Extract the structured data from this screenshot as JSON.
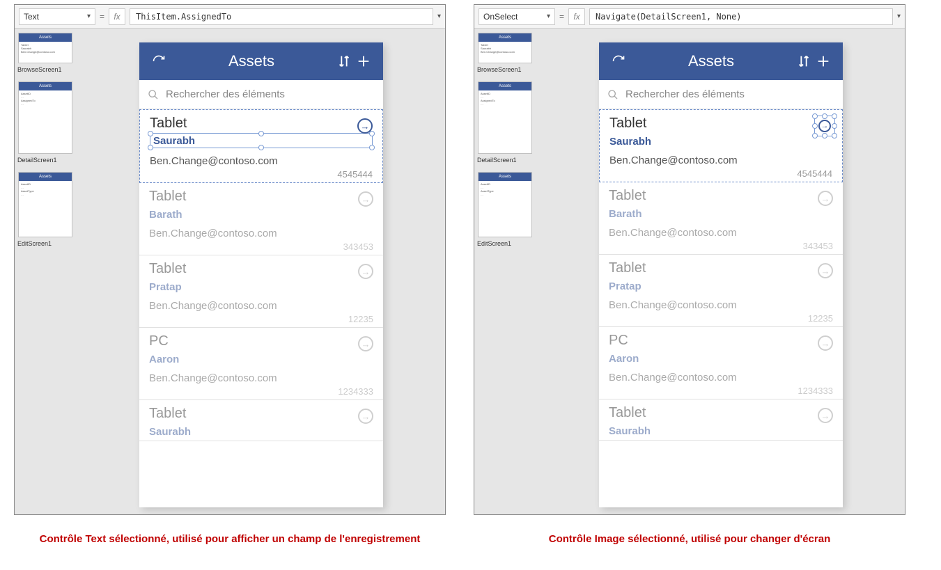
{
  "left": {
    "prop_selector": "Text",
    "formula": "ThisItem.AssignedTo",
    "caption": "Contrôle Text sélectionné, utilisé pour afficher un champ de l'enregistrement"
  },
  "right": {
    "prop_selector": "OnSelect",
    "formula": "Navigate(DetailScreen1, None)",
    "caption": "Contrôle Image sélectionné, utilisé pour changer d'écran"
  },
  "phone": {
    "title": "Assets",
    "search_placeholder": "Rechercher des éléments",
    "rows": [
      {
        "title": "Tablet",
        "sub1": "Saurabh",
        "sub2": "Ben.Change@contoso.com",
        "meta": "4545444"
      },
      {
        "title": "Tablet",
        "sub1": "Barath",
        "sub2": "Ben.Change@contoso.com",
        "meta": "343453"
      },
      {
        "title": "Tablet",
        "sub1": "Pratap",
        "sub2": "Ben.Change@contoso.com",
        "meta": "12235"
      },
      {
        "title": "PC",
        "sub1": "Aaron",
        "sub2": "Ben.Change@contoso.com",
        "meta": "1234333"
      },
      {
        "title": "Tablet",
        "sub1": "Saurabh",
        "sub2": "",
        "meta": ""
      }
    ]
  },
  "thumbs": [
    {
      "label": "BrowseScreen1",
      "title": "Assets"
    },
    {
      "label": "DetailScreen1",
      "title": "Assets"
    },
    {
      "label": "EditScreen1",
      "title": "Assets"
    }
  ]
}
